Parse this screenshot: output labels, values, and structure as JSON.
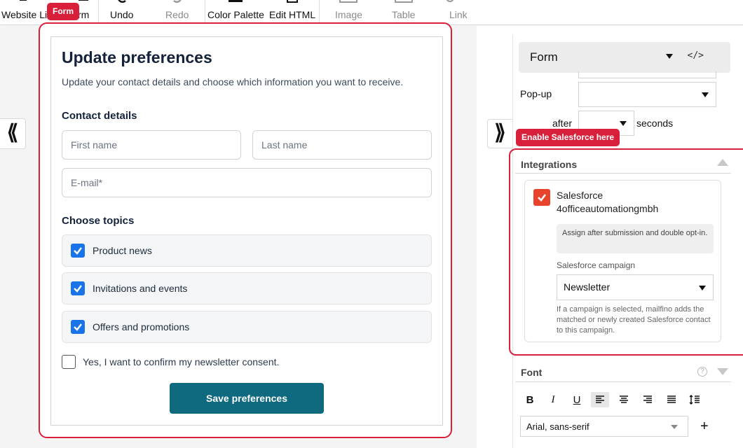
{
  "toolbar": {
    "website_link": "Website Li",
    "form_partial": "rm",
    "form_tag": "Form",
    "undo": "Undo",
    "redo": "Redo",
    "color_palette": "Color Palette",
    "edit_html": "Edit HTML",
    "image": "Image",
    "table": "Table",
    "link": "Link"
  },
  "nav": {
    "collapse_left": "⟪",
    "expand_right": "⟫"
  },
  "form": {
    "title": "Update preferences",
    "description": "Update your contact details and choose which information you want to receive.",
    "contact_heading": "Contact details",
    "first_name_placeholder": "First name",
    "last_name_placeholder": "Last name",
    "email_placeholder": "E-mail*",
    "topics_heading": "Choose topics",
    "topics": [
      {
        "label": "Product news",
        "checked": true
      },
      {
        "label": "Invitations and events",
        "checked": true
      },
      {
        "label": "Offers and promotions",
        "checked": true
      }
    ],
    "consent_label": "Yes, I want to confirm my newsletter consent.",
    "save_label": "Save preferences"
  },
  "panel": {
    "form_select": "Form",
    "code_icon": "</>",
    "popup_label": "Pop-up",
    "after_label": "after",
    "seconds_label": "seconds",
    "sf_tag": "Enable Salesforce here",
    "integrations_heading": "Integrations",
    "salesforce_name": "Salesforce",
    "salesforce_account": "4officeautomationgmbh",
    "salesforce_checked": true,
    "assign_note": "Assign after submission and double opt-in.",
    "campaign_label": "Salesforce campaign",
    "campaign_value": "Newsletter",
    "campaign_help": "If a campaign is selected, mailfino adds the matched or newly created Salesforce contact to this campaign.",
    "font_heading": "Font",
    "help_icon": "?",
    "font_family": "Arial, sans-serif",
    "plus": "+"
  },
  "colors": {
    "accent_red": "#d8203a",
    "checkbox_blue": "#1874e8",
    "save_button": "#0f6a80",
    "salesforce_checkbox": "#e8442c"
  }
}
